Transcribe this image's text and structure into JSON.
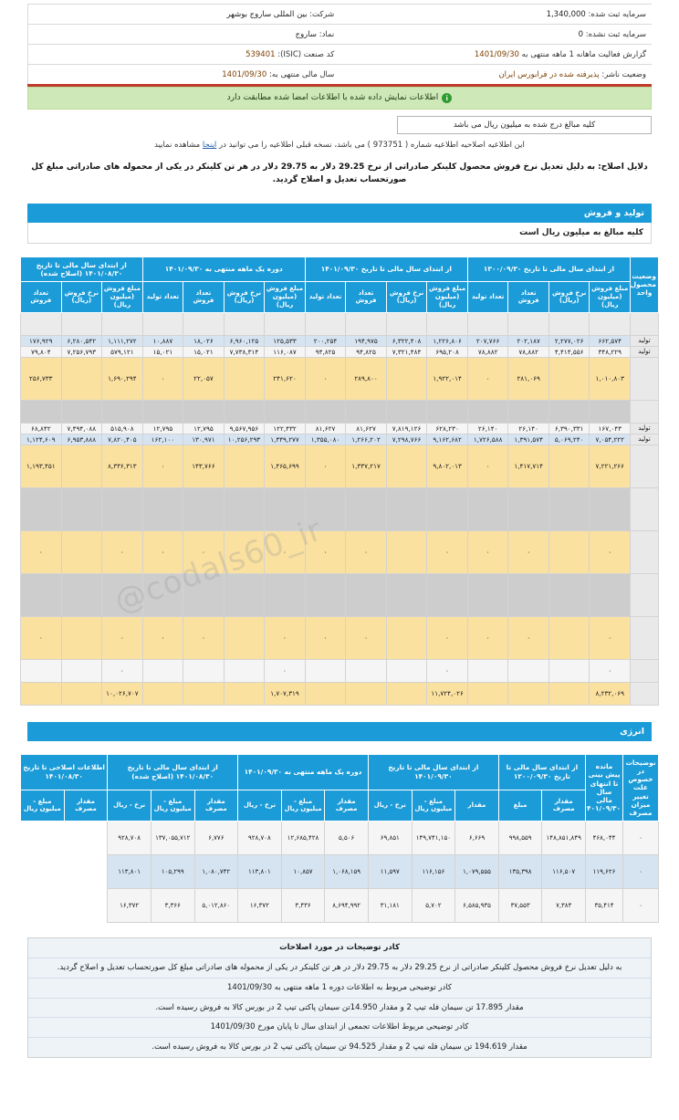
{
  "header": {
    "rows": [
      {
        "right_label": "شرکت:",
        "right_value": "بین المللی ساروج بوشهر",
        "left_label": "سرمایه ثبت شده:",
        "left_value": "1,340,000"
      },
      {
        "right_label": "نماد:",
        "right_value": "ساروج",
        "left_label": "سرمایه ثبت نشده:",
        "left_value": "0"
      },
      {
        "right_label": "کد صنعت (ISIC):",
        "right_value": "539401",
        "left_label": "گزارش فعالیت ماهانه  1 ماهه منتهی به",
        "left_value": "1401/09/30"
      },
      {
        "right_label": "سال مالی منتهی به:",
        "right_value": "1401/09/30",
        "left_label": "وضعیت ناشر:",
        "left_value": "پذیرفته شده در فرابورس ایران"
      }
    ]
  },
  "banner": {
    "icon": "info-icon",
    "text": "اطلاعات نمایش داده شده با اطلاعات امضا شده مطابقت دارد"
  },
  "note_box": "کلیه مبالغ درج شده به میلیون ریال می باشد",
  "amendment": {
    "pre": "این اطلاعیه اصلاحیه اطلاعیه شماره (",
    "number": "973751",
    "mid": ") می باشد، نسخه قبلی اطلاعیه را می توانید در",
    "link": "اینجا",
    "post": "مشاهده نمایید"
  },
  "reason": "دلایل اصلاح: به دلیل تعدیل نرخ فروش محصول کلینکر صادراتی از نرخ 29.25 دلار به 29.75 دلار در هر تن کلینکر در یکی از محموله های صادراتی مبلغ کل صورتحساب تعدیل و اصلاح گردید.",
  "production": {
    "section_title": "تولید و فروش",
    "section_subtitle": "کلیه مبالغ به میلیون ریال است",
    "group_headers": [
      "از ابتدای سال مالی تا تاریخ ۱۳۰۰/۰۹/۳۰",
      "از ابتدای سال مالی تا تاریخ ۱۴۰۱/۰۹/۳۰",
      "دوره یک ماهه منتهی به ۱۴۰۱/۰۹/۳۰",
      "از ابتدای سال مالی تا تاریخ ۱۴۰۱/۰۸/۳۰ (اصلاح شده)"
    ],
    "unit_header": "وضعیت محصول- واحد",
    "sub_headers": [
      "مبلغ فروش (میلیون ریال)",
      "نرخ فروش (ریال)",
      "تعداد فروش",
      "تعداد تولید",
      "مبلغ فروش (میلیون ریال)",
      "نرخ فروش (ریال)",
      "تعداد فروش",
      "تعداد تولید",
      "مبلغ فروش (میلیون ریال)",
      "نرخ فروش (ریال)",
      "تعداد فروش",
      "تعداد تولید",
      "مبلغ فروش (میلیون ریال)",
      "نرخ فروش (ریال)",
      "تعداد فروش"
    ],
    "rows": [
      {
        "style": "r-gray",
        "tall": "r-mid",
        "unit": "",
        "cells": [
          "",
          "",
          "",
          "",
          "",
          "",
          "",
          "",
          "",
          "",
          "",
          "",
          "",
          "",
          ""
        ]
      },
      {
        "style": "r-blue",
        "tall": "",
        "unit": "تولید",
        "cells": [
          "۶۶۲,۵۷۴",
          "۲,۲۷۷,۰۲۶",
          "۲۰۲,۱۸۷",
          "۲۰۷,۷۶۶",
          "۱,۲۲۶,۸۰۶",
          "۶,۳۲۲,۴۰۸",
          "۱۹۴,۹۷۵",
          "۲۰۰,۲۵۴",
          "۱۲۵,۵۳۳",
          "۶,۹۶۰,۱۲۵",
          "۱۸,۰۲۶",
          "۱۰,۸۸۷",
          "۱,۱۱۱,۲۷۲",
          "۶,۲۸۰,۵۴۲",
          "۱۷۶,۹۲۹"
        ]
      },
      {
        "style": "r-white",
        "tall": "",
        "unit": "تولید",
        "cells": [
          "۳۴۸,۲۲۹",
          "۴,۴۱۴,۵۵۶",
          "۷۸,۸۸۲",
          "۷۸,۸۸۲",
          "۶۹۵,۲۰۸",
          "۷,۳۲۱,۴۸۴",
          "۹۴,۸۲۵",
          "۹۴,۸۲۵",
          "۱۱۶,۰۸۷",
          "۷,۷۳۸,۳۱۴",
          "۱۵,۰۲۱",
          "۱۵,۰۲۱",
          "۵۷۹,۱۲۱",
          "۷,۲۵۶,۷۹۳",
          "۷۹,۸۰۴"
        ]
      },
      {
        "style": "r-amber",
        "tall": "r-xtall",
        "unit": "",
        "cells": [
          "۱,۰۱۰,۸۰۳",
          "",
          "۲۸۱,۰۶۹",
          "۰",
          "۱,۹۲۲,۰۱۴",
          "",
          "۲۸۹,۸۰۰",
          "۰",
          "۲۴۱,۶۲۰",
          "",
          "۲۲,۰۵۷",
          "۰",
          "۱,۶۹۰,۲۹۴",
          "",
          "۲۵۶,۷۳۳"
        ]
      },
      {
        "style": "r-gray2",
        "tall": "r-mid",
        "unit": "",
        "cells": [
          "",
          "",
          "",
          "",
          "",
          "",
          "",
          "",
          "",
          "",
          "",
          "",
          "",
          "",
          ""
        ]
      },
      {
        "style": "r-white",
        "tall": "",
        "unit": "تولید",
        "cells": [
          "۱۶۷,۰۴۳",
          "۶,۳۹۰,۳۳۱",
          "۲۶,۱۴۰",
          "۲۶,۱۴۰",
          "۶۲۸,۲۳۰",
          "۷,۸۱۹,۱۲۶",
          "۸۱,۶۲۷",
          "۸۱,۶۲۷",
          "۱۲۲,۴۳۲",
          "۹,۵۶۷,۹۵۶",
          "۱۲,۷۹۵",
          "۱۲,۷۹۵",
          "۵۱۵,۹۰۸",
          "۷,۴۹۴,۰۸۸",
          "۶۸,۸۴۲"
        ]
      },
      {
        "style": "r-blue",
        "tall": "",
        "unit": "تولید",
        "cells": [
          "۷,۰۵۴,۲۲۲",
          "۵,۰۶۹,۲۴۰",
          "۱,۳۹۱,۵۷۴",
          "۱,۷۲۶,۵۸۸",
          "۹,۱۶۲,۶۸۲",
          "۷,۲۹۸,۷۶۶",
          "۱,۲۶۶,۲۰۲",
          "۱,۳۵۵,۰۸۰",
          "۱,۳۴۹,۲۷۷",
          "۱۰,۲۵۶,۲۹۳",
          "۱۳۰,۹۷۱",
          "۱۶۲,۱۰۰",
          "۷,۸۲۰,۴۰۵",
          "۶,۹۵۳,۸۸۸",
          "۱,۱۲۴,۶۰۹"
        ]
      },
      {
        "style": "r-amber",
        "tall": "r-xtall",
        "unit": "",
        "cells": [
          "۷,۲۲۱,۲۶۶",
          "",
          "۱,۴۱۷,۷۱۴",
          "۰",
          "۹,۸۰۲,۰۱۳",
          "",
          "۱,۳۳۷,۲۱۷",
          "۰",
          "۱,۴۶۵,۶۹۹",
          "",
          "۱۴۳,۷۶۶",
          "۰",
          "۸,۳۳۶,۳۱۳",
          "",
          "۱,۱۹۳,۴۵۱"
        ]
      },
      {
        "style": "r-gray2",
        "tall": "r-xtall",
        "unit": "",
        "cells": [
          "",
          "",
          "",
          "",
          "",
          "",
          "",
          "",
          "",
          "",
          "",
          "",
          "",
          "",
          ""
        ]
      },
      {
        "style": "r-amber",
        "tall": "r-xtall",
        "unit": "",
        "cells": [
          "۰",
          "",
          "۰",
          "۰",
          "۰",
          "",
          "۰",
          "۰",
          "۰",
          "",
          "۰",
          "۰",
          "۰",
          "",
          "۰"
        ]
      },
      {
        "style": "r-gray2",
        "tall": "r-xtall",
        "unit": "",
        "cells": [
          "",
          "",
          "",
          "",
          "",
          "",
          "",
          "",
          "",
          "",
          "",
          "",
          "",
          "",
          ""
        ]
      },
      {
        "style": "r-amber",
        "tall": "r-xtall",
        "unit": "",
        "cells": [
          "۰",
          "",
          "۰",
          "۰",
          "۰",
          "",
          "۰",
          "۰",
          "۰",
          "",
          "۰",
          "۰",
          "۰",
          "",
          "۰"
        ]
      },
      {
        "style": "r-white",
        "tall": "r-mid",
        "unit": "",
        "cells": [
          "۰",
          "",
          "",
          "",
          "۰",
          "",
          "",
          "",
          "۰",
          "",
          "",
          "",
          "۰",
          "",
          ""
        ]
      },
      {
        "style": "r-amber",
        "tall": "r-mid",
        "unit": "",
        "cells": [
          "۸,۲۳۲,۰۶۹",
          "",
          "",
          "",
          "۱۱,۷۲۴,۰۲۶",
          "",
          "",
          "",
          "۱,۷۰۷,۳۱۹",
          "",
          "",
          "",
          "۱۰,۰۲۶,۷۰۷",
          "",
          ""
        ]
      }
    ]
  },
  "energy": {
    "section_title": "انرژی",
    "group_headers": [
      "از ابتدای سال مالی تا تاریخ ۱۲۰۰/۰۹/۳۰",
      "از ابتدای سال مالی تا تاریخ ۱۴۰۱/۰۹/۳۰",
      "دوره یک ماهه منتهی به ۱۴۰۱/۰۹/۳۰",
      "از ابتدای سال مالی تا تاریخ ۱۴۰۱/۰۸/۳۰ (اصلاح شده)",
      "اطلاعات اصلاحی تا تاریخ ۱۴۰۱/۰۸/۳۰"
    ],
    "col_notes": "نوضیحات در خصوص علت تغییر میزان مصرف",
    "col_balance": "مانده پیش بینی تا انتهای سال مالی ۱۴۰۱/۰۹/۳۰",
    "sub_headers": [
      "مقدار مصرف",
      "مبلغ",
      "مقدار",
      "مبلغ - میلیون ریال",
      "نرخ - ریال",
      "مقدار مصرف",
      "مبلغ - میلیون ریال",
      "نرخ - ریال",
      "مقدار مصرف",
      "مبلغ - میلیون ریال",
      "نرخ - ریال",
      "مقدار مصرف",
      "مبلغ - میلیون ریال"
    ],
    "rows": [
      {
        "style": "r-white",
        "cells": [
          "۰",
          "۴۶۸,۰۴۴",
          "۱۴۸,۸۵۱,۸۴۹",
          "۹۹۸,۵۵۹",
          "۶,۶۶۹",
          "۱۴۹,۷۴۱,۱۵۰",
          "۶۹,۸۵۱",
          "۵,۵۰۶",
          "۱۲,۶۸۵,۴۲۸",
          "۹۲۸,۷۰۸",
          "۶,۷۷۶",
          "۱۳۷,۰۵۵,۷۱۲",
          "۹۲۸,۷۰۸"
        ]
      },
      {
        "style": "r-blue",
        "cells": [
          "۰",
          "۱۱۹,۶۲۶",
          "۱۱۶,۵۰۷",
          "۱۳۵,۳۹۸",
          "۱,۰۷۹,۵۵۵",
          "۱۱۶,۱۵۶",
          "۱۱,۵۹۷",
          "۱,۰۶۸,۱۵۹",
          "۱۰,۸۵۷",
          "۱۱۳,۸۰۱",
          "۱,۰۸۰,۷۴۲",
          "۱۰۵,۲۹۹",
          "۱۱۳,۸۰۱"
        ]
      },
      {
        "style": "r-white",
        "cells": [
          "۰",
          "۳۵,۴۱۴",
          "۷,۳۸۴",
          "۳۷,۵۵۳",
          "۶,۵۸۵,۹۳۵",
          "۵,۷۰۲",
          "۳۱,۱۸۱",
          "۸,۶۹۴,۹۹۲",
          "۳,۴۳۶",
          "۱۶,۳۷۲",
          "۵,۰۱۲,۸۶۰",
          "۳,۳۶۶",
          "۱۶,۳۷۲"
        ]
      }
    ]
  },
  "notes": {
    "title": "کادر توضیحات در مورد اصلاحات",
    "items": [
      {
        "text": "به دلیل تعدیل نرخ فروش محصول کلینکر صادراتی از نرخ 29.25 دلار به 29.75 دلار در هر تن کلینکر در یکی از محموله های صادراتی مبلغ کل صورتحساب تعدیل و اصلاح گردید.",
        "bold": false
      },
      {
        "text": "کادر توضیحی مربوط به اطلاعات دوره 1 ماهه منتهی به 1401/09/30",
        "bold": false
      },
      {
        "text": "مقدار 17.895 تن سیمان فله تیپ 2 و مقدار 14.950تن سیمان پاکتی تیپ 2 در بورس کالا به فروش رسیده است.",
        "bold": false
      },
      {
        "text": "کادر توضیحی مربوط اطلاعات تجمعی از ابتدای سال تا پایان مورخ 1401/09/30",
        "bold": false
      },
      {
        "text": "مقدار 194.619 تن سیمان فله تیپ 2 و مقدار 94.525 تن سیمان پاکتی تیپ 2 در بورس کالا به فروش رسیده است.",
        "bold": false
      }
    ]
  },
  "watermark": "@codals60_ir"
}
